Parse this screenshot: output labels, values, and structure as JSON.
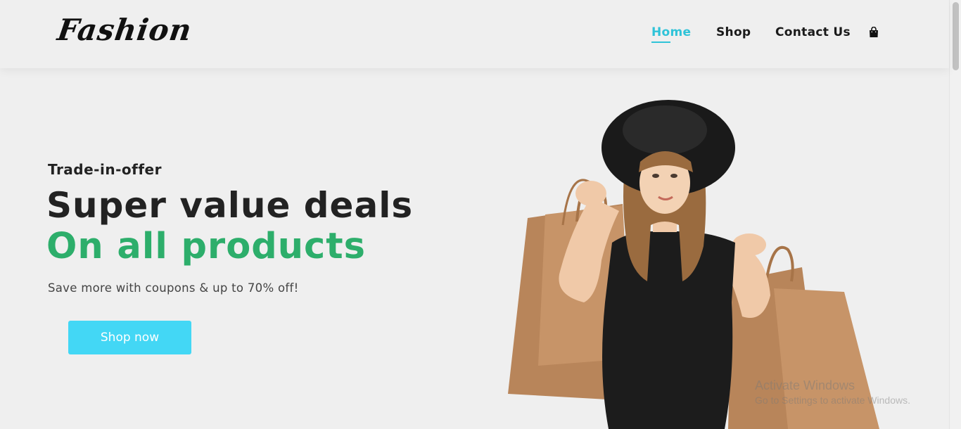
{
  "brand": {
    "logo_text": "Fashion"
  },
  "nav": {
    "items": [
      {
        "label": "Home",
        "active": true
      },
      {
        "label": "Shop",
        "active": false
      },
      {
        "label": "Contact Us",
        "active": false
      }
    ],
    "cart_icon": "shopping-bag-icon"
  },
  "hero": {
    "eyebrow": "Trade-in-offer",
    "headline": "Super value deals",
    "headline_accent": "On all products",
    "subtext": "Save more with coupons & up to 70% off!",
    "cta_label": "Shop now",
    "image": "woman-with-shopping-bags"
  },
  "watermark": {
    "title": "Activate Windows",
    "subtitle": "Go to Settings to activate Windows."
  },
  "colors": {
    "accent": "#2fc3d8",
    "headline_accent": "#2dae6b",
    "cta_background": "#43d7f5",
    "background": "#efefef"
  }
}
